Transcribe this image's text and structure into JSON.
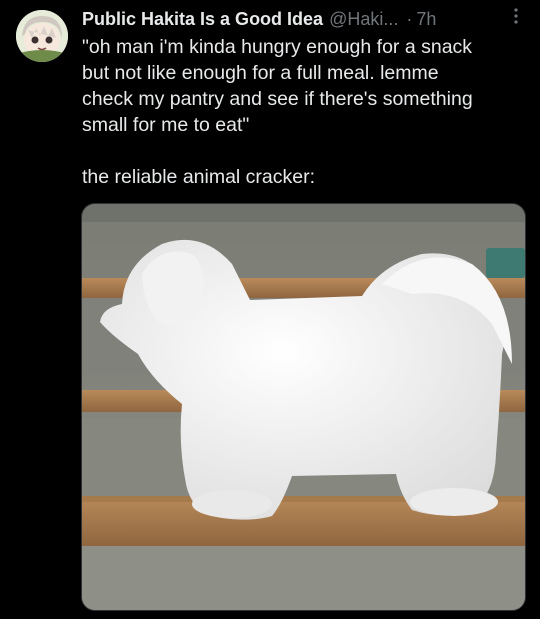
{
  "tweet": {
    "author_name": "Public Hakita Is a Good Idea",
    "author_handle": "@Haki...",
    "separator": "·",
    "time": "7h",
    "text": "\"oh man i'm kinda hungry enough for a snack\nbut not like enough for a full meal. lemme\ncheck my pantry and see if there's something\nsmall for me to eat\"\n\nthe reliable animal cracker:"
  },
  "icons": {
    "avatar": "anime-girl-avatar",
    "more": "more-vertical-icon"
  },
  "colors": {
    "background": "#000000",
    "text": "#e7e9ea",
    "muted": "#71767b"
  }
}
